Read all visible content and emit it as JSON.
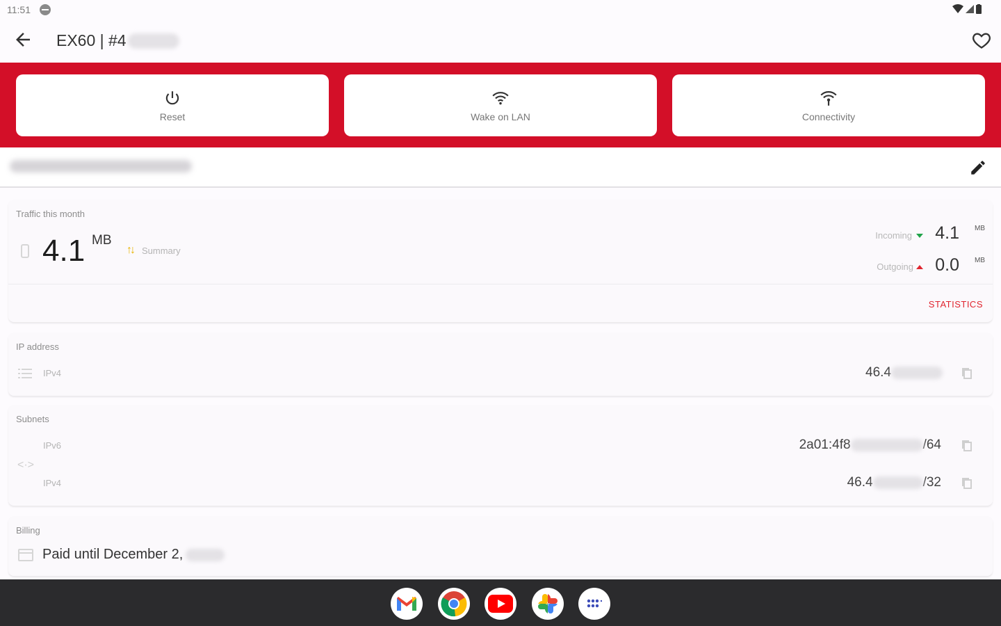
{
  "status_bar": {
    "time": "11:51"
  },
  "app_bar": {
    "title": "EX60 | #4"
  },
  "actions": [
    {
      "label": "Reset",
      "icon": "power-icon"
    },
    {
      "label": "Wake on LAN",
      "icon": "wifi-icon"
    },
    {
      "label": "Connectivity",
      "icon": "wifi-signal-icon"
    }
  ],
  "traffic": {
    "label": "Traffic this month",
    "total_value": "4.1",
    "total_unit": "MB",
    "summary_label": "Summary",
    "incoming_label": "Incoming",
    "incoming_value": "4.1",
    "incoming_unit": "MB",
    "outgoing_label": "Outgoing",
    "outgoing_value": "0.0",
    "outgoing_unit": "MB",
    "statistics_label": "STATISTICS",
    "incoming_color": "#21a44a",
    "outgoing_color": "#e0252f"
  },
  "ip_address": {
    "label": "IP address",
    "rows": [
      {
        "type": "IPv4",
        "value": "46.4"
      }
    ]
  },
  "subnets": {
    "label": "Subnets",
    "rows": [
      {
        "type": "IPv6",
        "value_prefix": "2a01:4f8",
        "value_suffix": "/64"
      },
      {
        "type": "IPv4",
        "value_prefix": "46.4",
        "value_suffix": "/32"
      }
    ]
  },
  "billing": {
    "label": "Billing",
    "text": "Paid until December 2,"
  },
  "colors": {
    "accent": "#d30f28",
    "dock": "#2b2b2d"
  },
  "dock": [
    "gmail-icon",
    "chrome-icon",
    "youtube-icon",
    "photos-icon",
    "app-launcher-icon"
  ]
}
